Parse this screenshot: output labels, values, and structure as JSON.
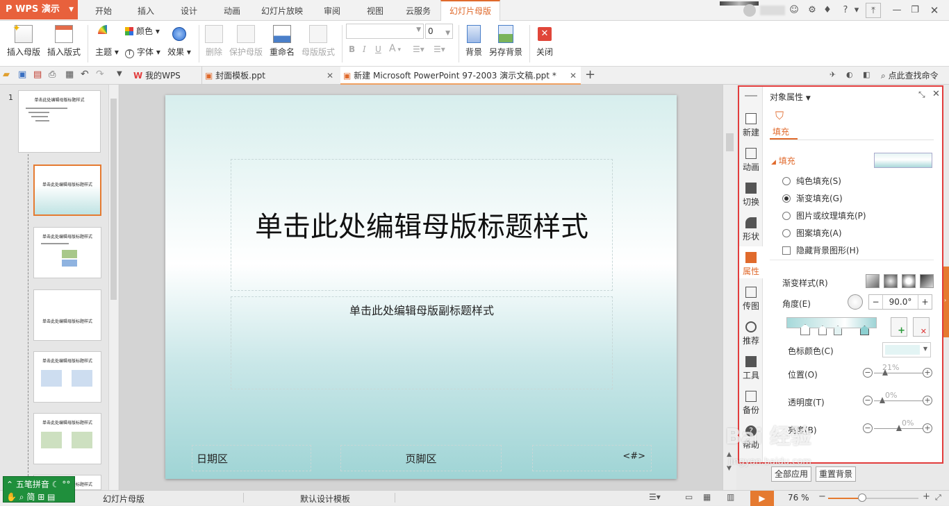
{
  "app": {
    "name": "WPS 演示"
  },
  "menu_tabs": [
    "开始",
    "插入",
    "设计",
    "动画",
    "幻灯片放映",
    "审阅",
    "视图",
    "云服务",
    "幻灯片母版"
  ],
  "active_menu_tab": "幻灯片母版",
  "ribbon": {
    "insert_master": "插入母版",
    "insert_layout": "插入版式",
    "theme": "主题",
    "color": "颜色",
    "font": "字体",
    "effect": "效果",
    "delete": "删除",
    "protect_master": "保护母版",
    "rename": "重命名",
    "master_layout": "母版版式",
    "font_size_value": "0",
    "background": "背景",
    "save_background": "另存背景",
    "close": "关闭"
  },
  "doc_tabs": {
    "my_wps": "我的WPS",
    "tab2": "封面模板.ppt",
    "tab3": "新建 Microsoft PowerPoint 97-2003 演示文稿.ppt *",
    "search": "点此查找命令"
  },
  "thumbs": {
    "slide_number": "1",
    "title_text": "单击此处编辑母版标题样式"
  },
  "slide": {
    "title": "单击此处编辑母版标题样式",
    "subtitle": "单击此处编辑母版副标题样式",
    "date": "日期区",
    "footer": "页脚区",
    "page_num": "<#>"
  },
  "pane": {
    "header": "对象属性",
    "tab_fill": "填充",
    "section_fill": "填充",
    "side": [
      "新建",
      "动画",
      "切换",
      "形状",
      "属性",
      "传图",
      "推荐",
      "工具",
      "备份",
      "帮助"
    ],
    "options": {
      "solid": "纯色填充(S)",
      "gradient": "渐变填充(G)",
      "picture": "图片或纹理填充(P)",
      "pattern": "图案填充(A)",
      "hide_bg": "隐藏背景图形(H)"
    },
    "gradient_style": "渐变样式(R)",
    "angle_label": "角度(E)",
    "angle_value": "90.0°",
    "stop_color": "色标颜色(C)",
    "position_label": "位置(O)",
    "position_value": "21%",
    "position_level": 0.21,
    "transparency_label": "透明度(T)",
    "transparency_value": "0%",
    "brightness_label": "亮度(B)",
    "brightness_value": "0%",
    "apply_all": "全部应用",
    "reset_bg": "重置背景"
  },
  "ime": {
    "name": "五笔拼音",
    "mode": "简"
  },
  "status": {
    "view_name": "幻灯片母版",
    "template": "默认设计模板",
    "zoom": "76 %",
    "zoom_level": 0.38
  },
  "colors": {
    "accent": "#e06a2c",
    "app_button": "#e8613c",
    "pane_border": "#e23c3c",
    "ime": "#1f8f3c"
  },
  "watermark": {
    "text": "Bai 经验",
    "sub": "jingyan.baidu.com"
  }
}
